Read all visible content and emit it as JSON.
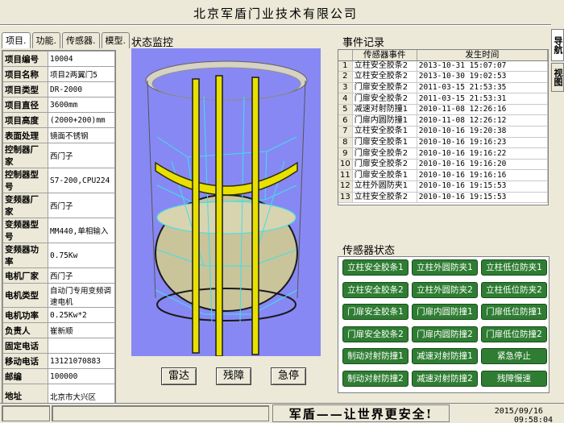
{
  "app": {
    "title": "北京军盾门业技术有限公司"
  },
  "side_tabs": [
    {
      "label": "导航"
    },
    {
      "label": "视图"
    }
  ],
  "tabs": [
    {
      "label": "项目."
    },
    {
      "label": "功能."
    },
    {
      "label": "传感器."
    },
    {
      "label": "模型."
    }
  ],
  "project_info": [
    {
      "key": "项目编号",
      "value": "10004"
    },
    {
      "key": "项目名称",
      "value": "项目2两翼门5"
    },
    {
      "key": "项目类型",
      "value": "DR-2000"
    },
    {
      "key": "项目直径",
      "value": "3600mm"
    },
    {
      "key": "项目高度",
      "value": "(2000+200)mm"
    },
    {
      "key": "表面处理",
      "value": "镜面不锈钢"
    },
    {
      "key": "控制器厂家",
      "value": "西门子"
    },
    {
      "key": "控制器型号",
      "value": "S7-200,CPU224"
    },
    {
      "key": "变频器厂家",
      "value": "西门子"
    },
    {
      "key": "变频器型号",
      "value": "MM440,单相输入"
    },
    {
      "key": "变频器功率",
      "value": "0.75Kw"
    },
    {
      "key": "电机厂家",
      "value": "西门子"
    },
    {
      "key": "电机类型",
      "value": "自动门专用变频调速电机"
    },
    {
      "key": "电机功率",
      "value": "0.25Kw*2"
    },
    {
      "key": "负责人",
      "value": "崔新顺"
    },
    {
      "key": "固定电话",
      "value": ""
    },
    {
      "key": "移动电话",
      "value": "13121070883"
    },
    {
      "key": "邮编",
      "value": "100000"
    },
    {
      "key": "地址",
      "value": "北京市大兴区"
    }
  ],
  "monitor": {
    "title": "状态监控"
  },
  "controls": [
    {
      "label": "雷达"
    },
    {
      "label": "残障"
    },
    {
      "label": "急停"
    }
  ],
  "events": {
    "title": "事件记录",
    "columns": [
      "传感器事件",
      "发生时间"
    ],
    "rows": [
      {
        "n": "1",
        "event": "立柱安全胶条2",
        "time": "2013-10-31 15:07:07"
      },
      {
        "n": "2",
        "event": "立柱安全胶条2",
        "time": "2013-10-30 19:02:53"
      },
      {
        "n": "3",
        "event": "门扉安全胶条2",
        "time": "2011-03-15 21:53:35"
      },
      {
        "n": "4",
        "event": "门扉安全胶条2",
        "time": "2011-03-15 21:53:31"
      },
      {
        "n": "5",
        "event": "减速对射防撞1",
        "time": "2010-11-08 12:26:16"
      },
      {
        "n": "6",
        "event": "门扉内圆防撞1",
        "time": "2010-11-08 12:26:12"
      },
      {
        "n": "7",
        "event": "立柱安全胶条1",
        "time": "2010-10-16 19:20:38"
      },
      {
        "n": "8",
        "event": "门扉安全胶条1",
        "time": "2010-10-16 19:16:23"
      },
      {
        "n": "9",
        "event": "门扉安全胶条2",
        "time": "2010-10-16 19:16:22"
      },
      {
        "n": "10",
        "event": "门扉安全胶条2",
        "time": "2010-10-16 19:16:20"
      },
      {
        "n": "11",
        "event": "门扉安全胶条1",
        "time": "2010-10-16 19:16:16"
      },
      {
        "n": "12",
        "event": "立柱外圆防夹1",
        "time": "2010-10-16 19:15:53"
      },
      {
        "n": "13",
        "event": "立柱安全胶条2",
        "time": "2010-10-16 19:15:53"
      }
    ]
  },
  "sensors": {
    "title": "传感器状态",
    "items": [
      {
        "label": "立柱安全胶条1"
      },
      {
        "label": "立柱外圆防夹1"
      },
      {
        "label": "立柱低位防夹1"
      },
      {
        "label": "立柱安全胶条2"
      },
      {
        "label": "立柱外圆防夹2"
      },
      {
        "label": "立柱低位防夹2"
      },
      {
        "label": "门扉安全胶条1"
      },
      {
        "label": "门扉内圆防撞1"
      },
      {
        "label": "门扉低位防撞1"
      },
      {
        "label": "门扉安全胶条2"
      },
      {
        "label": "门扉内圆防撞2"
      },
      {
        "label": "门扉低位防撞2"
      },
      {
        "label": "制动对射防撞1"
      },
      {
        "label": "减速对射防撞1"
      },
      {
        "label": "紧急停止"
      },
      {
        "label": "制动对射防撞2"
      },
      {
        "label": "减速对射防撞2"
      },
      {
        "label": "残障慢速"
      }
    ]
  },
  "status_bar": {
    "slogan": "军盾——让世界更安全!",
    "date": "2015/09/16",
    "time": "09:58:04"
  },
  "colors": {
    "background": "#ECE9D8",
    "canvas": "#8888F4",
    "sensor_ok": "#2E7D32",
    "frame_yellow": "#E8E000",
    "cyan_line": "#40E0E8"
  },
  "icons": {
    "door_model": "revolving-door-3d-model"
  }
}
